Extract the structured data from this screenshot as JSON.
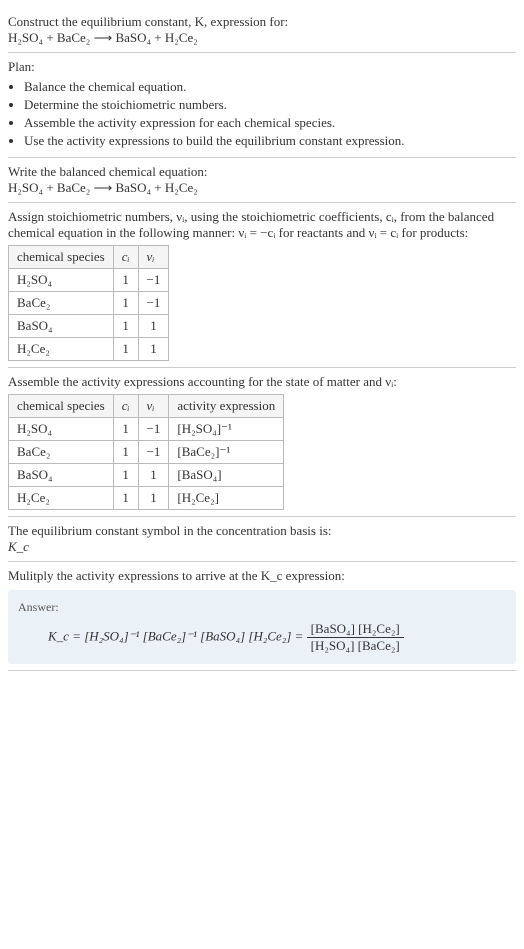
{
  "intro": {
    "line1": "Construct the equilibrium constant, K, expression for:",
    "equation": "H₂SO₄ + BaCe₂ ⟶ BaSO₄ + H₂Ce₂"
  },
  "plan": {
    "heading": "Plan:",
    "items": [
      "Balance the chemical equation.",
      "Determine the stoichiometric numbers.",
      "Assemble the activity expression for each chemical species.",
      "Use the activity expressions to build the equilibrium constant expression."
    ]
  },
  "balanced": {
    "heading": "Write the balanced chemical equation:",
    "equation": "H₂SO₄ + BaCe₂ ⟶ BaSO₄ + H₂Ce₂"
  },
  "stoich": {
    "text": "Assign stoichiometric numbers, νᵢ, using the stoichiometric coefficients, cᵢ, from the balanced chemical equation in the following manner: νᵢ = −cᵢ for reactants and νᵢ = cᵢ for products:",
    "headers": [
      "chemical species",
      "cᵢ",
      "νᵢ"
    ],
    "rows": [
      {
        "species": "H₂SO₄",
        "c": "1",
        "v": "−1"
      },
      {
        "species": "BaCe₂",
        "c": "1",
        "v": "−1"
      },
      {
        "species": "BaSO₄",
        "c": "1",
        "v": "1"
      },
      {
        "species": "H₂Ce₂",
        "c": "1",
        "v": "1"
      }
    ]
  },
  "activity": {
    "text": "Assemble the activity expressions accounting for the state of matter and νᵢ:",
    "headers": [
      "chemical species",
      "cᵢ",
      "νᵢ",
      "activity expression"
    ],
    "rows": [
      {
        "species": "H₂SO₄",
        "c": "1",
        "v": "−1",
        "expr": "[H₂SO₄]⁻¹"
      },
      {
        "species": "BaCe₂",
        "c": "1",
        "v": "−1",
        "expr": "[BaCe₂]⁻¹"
      },
      {
        "species": "BaSO₄",
        "c": "1",
        "v": "1",
        "expr": "[BaSO₄]"
      },
      {
        "species": "H₂Ce₂",
        "c": "1",
        "v": "1",
        "expr": "[H₂Ce₂]"
      }
    ]
  },
  "symbol": {
    "text": "The equilibrium constant symbol in the concentration basis is:",
    "ksymbol": "K_c"
  },
  "multiply": {
    "text": "Mulitply the activity expressions to arrive at the K_c expression:"
  },
  "answer": {
    "label": "Answer:",
    "lhs": "K_c = [H₂SO₄]⁻¹ [BaCe₂]⁻¹ [BaSO₄] [H₂Ce₂] = ",
    "num": "[BaSO₄] [H₂Ce₂]",
    "den": "[H₂SO₄] [BaCe₂]"
  }
}
